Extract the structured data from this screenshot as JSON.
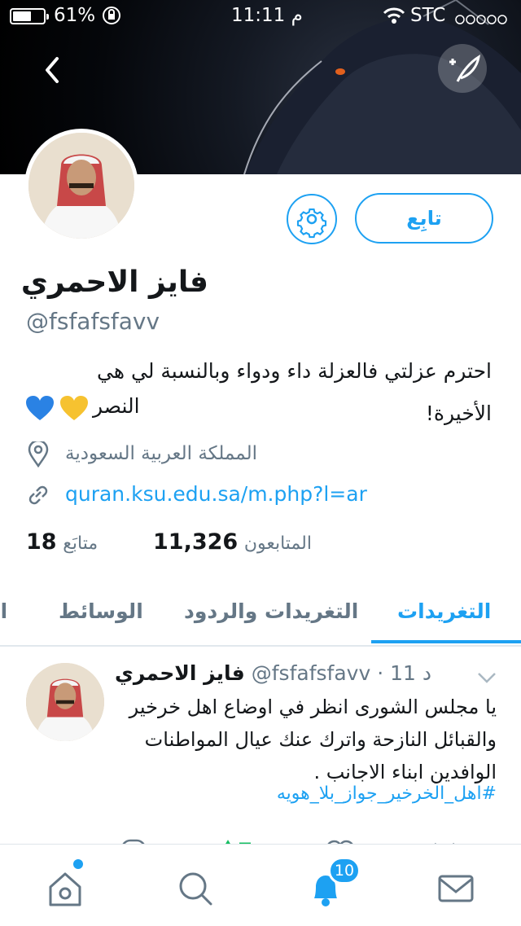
{
  "status_bar": {
    "battery_percent": "61%",
    "battery_level": 0.61,
    "time": "11:11 م",
    "carrier": "STC"
  },
  "profile": {
    "follow_label": "تابِع",
    "name": "فايز الاحمري",
    "handle": "@fsfafsfavv",
    "bio_line1": "احترم عزلتي فالعزلة داء ودواء وبالنسبة لي هي الأخيرة!",
    "bio_line2_text": "النصر",
    "location": "المملكة العربية السعودية",
    "website": "quran.ksu.edu.sa/m.php?l=ar",
    "following_count": "18",
    "following_label": "متابَع",
    "followers_count": "11,326",
    "followers_label": "المتابعون"
  },
  "tabs": [
    {
      "label": "التغريدات",
      "active": true
    },
    {
      "label": "التغريدات والردود",
      "active": false
    },
    {
      "label": "الوسائط",
      "active": false
    },
    {
      "label": "الإ",
      "active": false
    }
  ],
  "tweet": {
    "author_name": "فايز الاحمري",
    "author_handle": "@fsfafsfavv",
    "time": "11 د",
    "text": "يا مجلس الشورى انظر في اوضاع اهل خرخير والقبائل النازحة واترك عنك عيال المواطنات الوافدين ابناء الاجانب .",
    "hashtag": "#اهل_الخرخير_جواز_بلا_هويه"
  },
  "tabbar": {
    "notifications_badge": "10"
  },
  "colors": {
    "accent": "#1da1f2",
    "secondary_text": "#657786",
    "retweet_green": "#17bf63"
  }
}
